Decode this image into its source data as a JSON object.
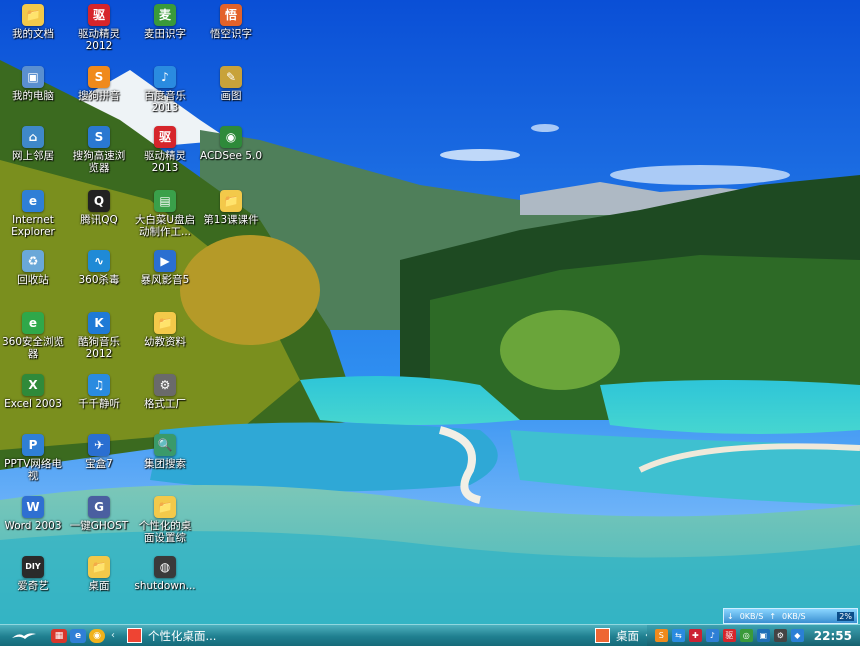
{
  "desktop": {
    "icons": [
      {
        "label": "我的文档",
        "icon": "documents-folder-icon",
        "glyph": "📁",
        "color": "#f3c94a"
      },
      {
        "label": "驱动精灵\n2012",
        "icon": "driver-genius-icon",
        "glyph": "驱",
        "color": "#d6252b"
      },
      {
        "label": "麦田识字",
        "icon": "maitian-literacy-icon",
        "glyph": "麦",
        "color": "#3a9a3a"
      },
      {
        "label": "悟空识字",
        "icon": "wukong-literacy-icon",
        "glyph": "悟",
        "color": "#e3622a"
      },
      {
        "label": "我的电脑",
        "icon": "my-computer-icon",
        "glyph": "▣",
        "color": "#5a8fd0"
      },
      {
        "label": "搜狗拼音",
        "icon": "sogou-pinyin-icon",
        "glyph": "S",
        "color": "#f08a1c"
      },
      {
        "label": "百度音乐\n2013",
        "icon": "baidu-music-icon",
        "glyph": "♪",
        "color": "#2a8be0"
      },
      {
        "label": "画图",
        "icon": "paint-icon",
        "glyph": "✎",
        "color": "#c8a23a"
      },
      {
        "label": "网上邻居",
        "icon": "network-neighborhood-icon",
        "glyph": "⌂",
        "color": "#3f88c9"
      },
      {
        "label": "搜狗高速浏\n览器",
        "icon": "sogou-browser-icon",
        "glyph": "S",
        "color": "#2a78d1"
      },
      {
        "label": "驱动精灵\n2013",
        "icon": "driver-genius-2013-icon",
        "glyph": "驱",
        "color": "#d6252b"
      },
      {
        "label": "ACDSee 5.0",
        "icon": "acdsee-icon",
        "glyph": "◉",
        "color": "#2e8a3a"
      },
      {
        "label": "Internet\nExplorer",
        "icon": "internet-explorer-icon",
        "glyph": "e",
        "color": "#2f7fd6"
      },
      {
        "label": "腾讯QQ",
        "icon": "qq-icon",
        "glyph": "Q",
        "color": "#222"
      },
      {
        "label": "大白菜U盘启\n动制作工...",
        "icon": "dabaicai-usb-icon",
        "glyph": "▤",
        "color": "#3aa04a"
      },
      {
        "label": "第13课课件",
        "icon": "lesson-folder-icon",
        "glyph": "📁",
        "color": "#f3c94a"
      },
      {
        "label": "回收站",
        "icon": "recycle-bin-icon",
        "glyph": "♻",
        "color": "#6aa8d8"
      },
      {
        "label": "360杀毒",
        "icon": "360-antivirus-icon",
        "glyph": "∿",
        "color": "#1f8ad6"
      },
      {
        "label": "暴风影音5",
        "icon": "baofeng-player-icon",
        "glyph": "▶",
        "color": "#2a6fd1"
      },
      {
        "label": "360安全浏览\n器",
        "icon": "360-browser-icon",
        "glyph": "e",
        "color": "#2fa84a"
      },
      {
        "label": "酷狗音乐\n2012",
        "icon": "kugou-music-icon",
        "glyph": "K",
        "color": "#1f7ad6"
      },
      {
        "label": "幼教资料",
        "icon": "preschool-folder-icon",
        "glyph": "📁",
        "color": "#f3c94a"
      },
      {
        "label": "Excel 2003",
        "icon": "excel-icon",
        "glyph": "X",
        "color": "#2f8a3a"
      },
      {
        "label": "千千静听",
        "icon": "ttplayer-icon",
        "glyph": "♫",
        "color": "#2a8be0"
      },
      {
        "label": "格式工厂",
        "icon": "format-factory-icon",
        "glyph": "⚙",
        "color": "#6a6a6a"
      },
      {
        "label": "PPTV网络电\n视",
        "icon": "pptv-icon",
        "glyph": "P",
        "color": "#2f7fd6"
      },
      {
        "label": "宝盒7",
        "icon": "baohe-icon",
        "glyph": "✈",
        "color": "#2a6fd1"
      },
      {
        "label": "集团搜索",
        "icon": "group-search-icon",
        "glyph": "🔍",
        "color": "#3a9a6a"
      },
      {
        "label": "Word 2003",
        "icon": "word-icon",
        "glyph": "W",
        "color": "#2f6fd1"
      },
      {
        "label": "一键GHOST",
        "icon": "onekey-ghost-icon",
        "glyph": "G",
        "color": "#4a5fa0"
      },
      {
        "label": "个性化的桌\n面设置综",
        "icon": "personalize-folder-icon",
        "glyph": "📁",
        "color": "#f3c94a"
      },
      {
        "label": "爱奇艺",
        "icon": "iqiyi-icon",
        "glyph": "DIY",
        "color": "#2a2a2a"
      },
      {
        "label": "桌面",
        "icon": "desktop-folder-icon",
        "glyph": "📁",
        "color": "#f3c94a"
      },
      {
        "label": "shutdown...",
        "icon": "shutdown-icon",
        "glyph": "◍",
        "color": "#3a3a3a"
      }
    ]
  },
  "net_widget": {
    "down": "0KB/S",
    "up": "0KB/S",
    "percent": "2%"
  },
  "taskbar": {
    "open_window_label": "个性化桌面...",
    "desktop_toolbar_label": "桌面",
    "arrow_left": "«",
    "arrow_sep": "‹",
    "clock": "22:55"
  }
}
